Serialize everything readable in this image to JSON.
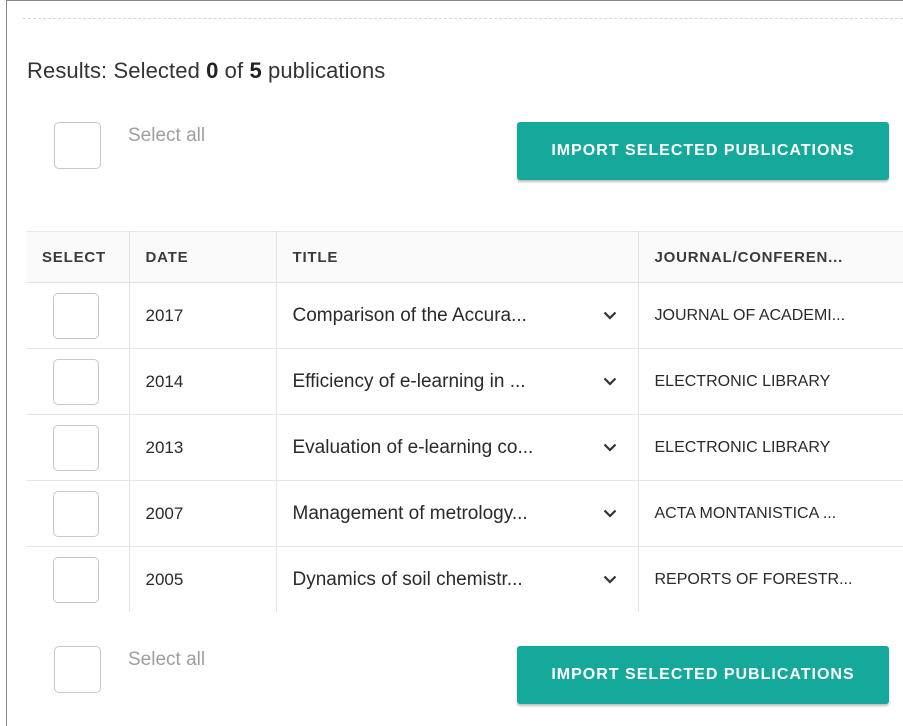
{
  "results": {
    "prefix": "Results: Selected ",
    "selected_count": "0",
    "middle": " of ",
    "total_count": "5",
    "suffix": " publications"
  },
  "select_all_label": "Select all",
  "import_button_label": "IMPORT SELECTED PUBLICATIONS",
  "table": {
    "columns": [
      "SELECT",
      "DATE",
      "TITLE",
      "JOURNAL/CONFEREN..."
    ],
    "rows": [
      {
        "date": "2017",
        "title": "Comparison of the Accura...",
        "journal": "JOURNAL OF ACADEMI..."
      },
      {
        "date": "2014",
        "title": "Efficiency of e-learning in ...",
        "journal": "ELECTRONIC LIBRARY"
      },
      {
        "date": "2013",
        "title": "Evaluation of e-learning co...",
        "journal": "ELECTRONIC LIBRARY"
      },
      {
        "date": "2007",
        "title": "Management of metrology...",
        "journal": "ACTA MONTANISTICA ..."
      },
      {
        "date": "2005",
        "title": "Dynamics of soil chemistr...",
        "journal": "REPORTS OF FORESTR..."
      }
    ]
  },
  "colors": {
    "accent": "#14a99a",
    "border": "#e6e6e6",
    "muted_text": "#9e9e9e"
  },
  "icons": {
    "row_expand": "chevron-down-icon"
  }
}
